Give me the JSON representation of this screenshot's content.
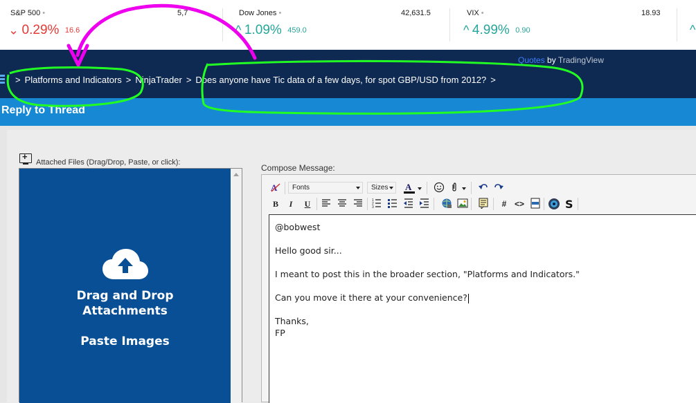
{
  "ticker": [
    {
      "name": "S&P 500",
      "price": "5,7",
      "change_pct": "0.29%",
      "change_abs": "16.6",
      "direction": "down"
    },
    {
      "name": "Dow Jones",
      "price": "42,631.5",
      "change_pct": "1.09%",
      "change_abs": "459.0",
      "direction": "up"
    },
    {
      "name": "VIX",
      "price": "18.93",
      "change_pct": "4.99%",
      "change_abs": "0.90",
      "direction": "up"
    }
  ],
  "colors": {
    "negative": "#e53935",
    "positive": "#26a69a",
    "nav_bg": "#0e2a52",
    "header_bg": "#1688d4",
    "drop_bg": "#084f96",
    "annotation_green": "#22ff22",
    "annotation_magenta": "#ee00ee"
  },
  "navbar": {
    "credit_link": "Quotes",
    "credit_by": " by ",
    "credit_tv": "TradingView",
    "breadcrumb": [
      {
        "label": "Platforms and Indicators"
      },
      {
        "label": "NinjaTrader"
      },
      {
        "label": "Does anyone have Tic data of a few days, for spot GBP/USD from 2012?"
      }
    ],
    "separator": ">"
  },
  "page": {
    "title": "Reply to Thread"
  },
  "attachments": {
    "label": "Attached Files (Drag/Drop, Paste, or click):",
    "drop_line1": "Drag and Drop",
    "drop_line2": "Attachments",
    "paste_line": "Paste Images",
    "icon": "cloud-upload-icon"
  },
  "compose": {
    "label": "Compose Message:",
    "toolbar": {
      "font_select": "Fonts",
      "size_select": "Sizes",
      "bold": "B",
      "italic": "I",
      "underline": "U"
    },
    "lines": [
      "@bobwest",
      "",
      "Hello good sir...",
      "",
      "I meant to post this in the broader section, \"Platforms and Indicators.\"",
      "",
      "Can you move it there at your convenience?",
      "",
      "Thanks,",
      "FP"
    ]
  }
}
